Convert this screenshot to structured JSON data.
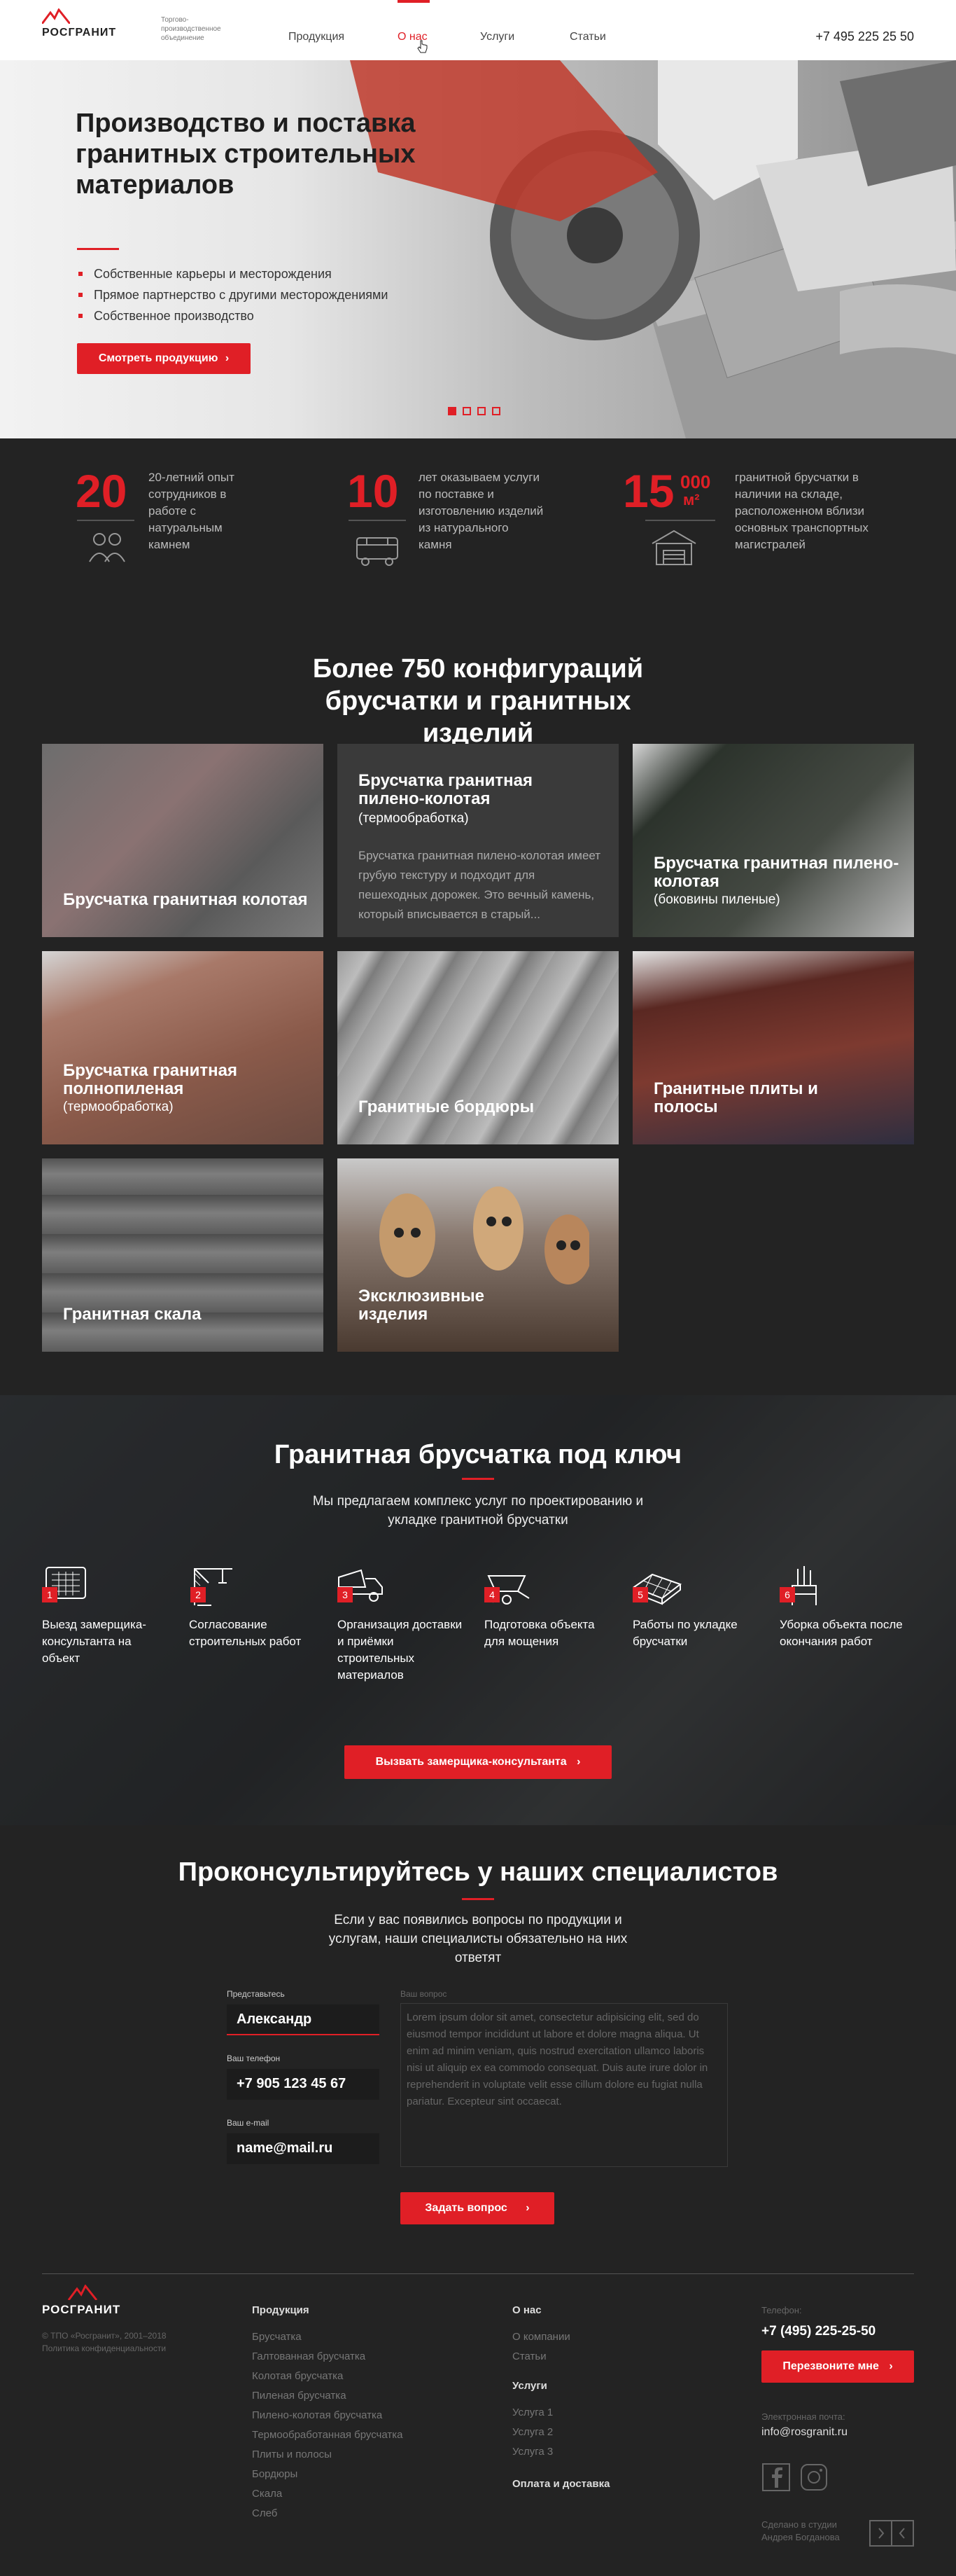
{
  "header": {
    "logo": "РОСГРАНИТ",
    "tagline": "Торгово-производственное объединение",
    "nav": [
      "Продукция",
      "О нас",
      "Услуги",
      "Статьи"
    ],
    "active_nav": "О нас",
    "phone": "+7 495 225 25 50"
  },
  "hero": {
    "title": "Производство и поставка гранитных строительных материалов",
    "bullets": [
      "Собственные карьеры и месторождения",
      "Прямое партнерство с другими месторождениями",
      "Собственное производство"
    ],
    "button": "Смотреть продукцию",
    "slides_total": 4,
    "slide_active": 1
  },
  "stats": [
    {
      "number": "20",
      "text": "20-летний опыт сотрудников в работе с натуральным камнем",
      "icon": "people-icon"
    },
    {
      "number": "10",
      "text": "лет оказываем услуги по поставке и изготовлению изделий из натурального камня",
      "icon": "truck-icon"
    },
    {
      "number": "15",
      "sup": "000",
      "unit": "м²",
      "text": "гранитной брусчатки в наличии на складе, расположенном вблизи основных транспортных магистралей",
      "icon": "warehouse-icon"
    }
  ],
  "catalog": {
    "title": "Более 750 конфигураций брусчатки и гранитных изделий",
    "cards": [
      {
        "title": "Брусчатка гранитная колотая",
        "note": ""
      },
      {
        "title": "Брусчатка гранитная пилено-колотая",
        "note": "(термообработка)",
        "desc": "Брусчатка гранитная пилено-колотая имеет грубую текстуру и подходит для пешеходных дорожек. Это вечный камень, который вписывается в старый..."
      },
      {
        "title": "Брусчатка гранитная пилено-колотая",
        "note": "(боковины пиленые)"
      },
      {
        "title": "Брусчатка гранитная полнопиленая",
        "note": "(термообработка)"
      },
      {
        "title": "Гранитные бордюры",
        "note": ""
      },
      {
        "title": "Гранитные плиты и полосы",
        "note": ""
      },
      {
        "title": "Гранитная скала",
        "note": ""
      },
      {
        "title": "Эксклюзивные изделия",
        "note": ""
      }
    ]
  },
  "turnkey": {
    "title": "Гранитная брусчатка под ключ",
    "subtitle": "Мы предлагаем комплекс услуг по проектированию и укладке гранитной брусчатки",
    "steps": [
      {
        "n": "1",
        "text": "Выезд замерщика-консультанта на объект",
        "icon": "tablet-icon"
      },
      {
        "n": "2",
        "text": "Согласование строительных работ",
        "icon": "crane-icon"
      },
      {
        "n": "3",
        "text": "Организация доставки и приёмки строительных материалов",
        "icon": "dump-truck-icon"
      },
      {
        "n": "4",
        "text": "Подготовка объекта для мощения",
        "icon": "wheelbarrow-icon"
      },
      {
        "n": "5",
        "text": "Работы по укладке брусчатки",
        "icon": "paving-icon"
      },
      {
        "n": "6",
        "text": "Уборка объекта после окончания работ",
        "icon": "broom-icon"
      }
    ],
    "button": "Вызвать замерщика-консультанта"
  },
  "consult": {
    "title": "Проконсультируйтесь у наших специалистов",
    "subtitle": "Если у вас появились вопросы по продукции и услугам, наши специалисты обязательно на них ответят",
    "name_label": "Представьтесь",
    "name_value": "Александр",
    "phone_label": "Ваш телефон",
    "phone_value": "+7 905 123 45 67",
    "email_label": "Ваш e-mail",
    "email_value": "name@mail.ru",
    "question_label": "Ваш вопрос",
    "question_value": "Lorem ipsum dolor sit amet, consectetur adipisicing elit, sed do eiusmod tempor incididunt ut labore et dolore magna aliqua. Ut enim ad minim veniam, quis nostrud exercitation ullamco laboris nisi ut aliquip ex ea commodo consequat. Duis aute irure dolor in reprehenderit in voluptate velit esse cillum dolore eu fugiat nulla pariatur. Excepteur sint occaecat.",
    "button": "Задать вопрос"
  },
  "footer": {
    "logo": "РОСГРАНИТ",
    "copyright": "© ТПО «Росгранит», 2001–2018",
    "privacy": "Политика конфиденциальности",
    "products_title": "Продукция",
    "products": [
      "Брусчатка",
      "Галтованная брусчатка",
      "Колотая брусчатка",
      "Пиленая брусчатка",
      "Пилено-колотая брусчатка",
      "Термообработанная брусчатка",
      "Плиты и полосы",
      "Бордюры",
      "Скала",
      "Слеб"
    ],
    "about_title": "О нас",
    "about": [
      "О компании",
      "Статьи"
    ],
    "services_title": "Услуги",
    "services": [
      "Услуга 1",
      "Услуга 2",
      "Услуга 3"
    ],
    "payment": "Оплата и доставка",
    "phone_label": "Телефон:",
    "phone": "+7 (495) 225-25-50",
    "callback": "Перезвоните мне",
    "email_label": "Электронная почта:",
    "email": "info@rosgranit.ru",
    "credit": "Сделано в студии Андрея Богданова"
  }
}
